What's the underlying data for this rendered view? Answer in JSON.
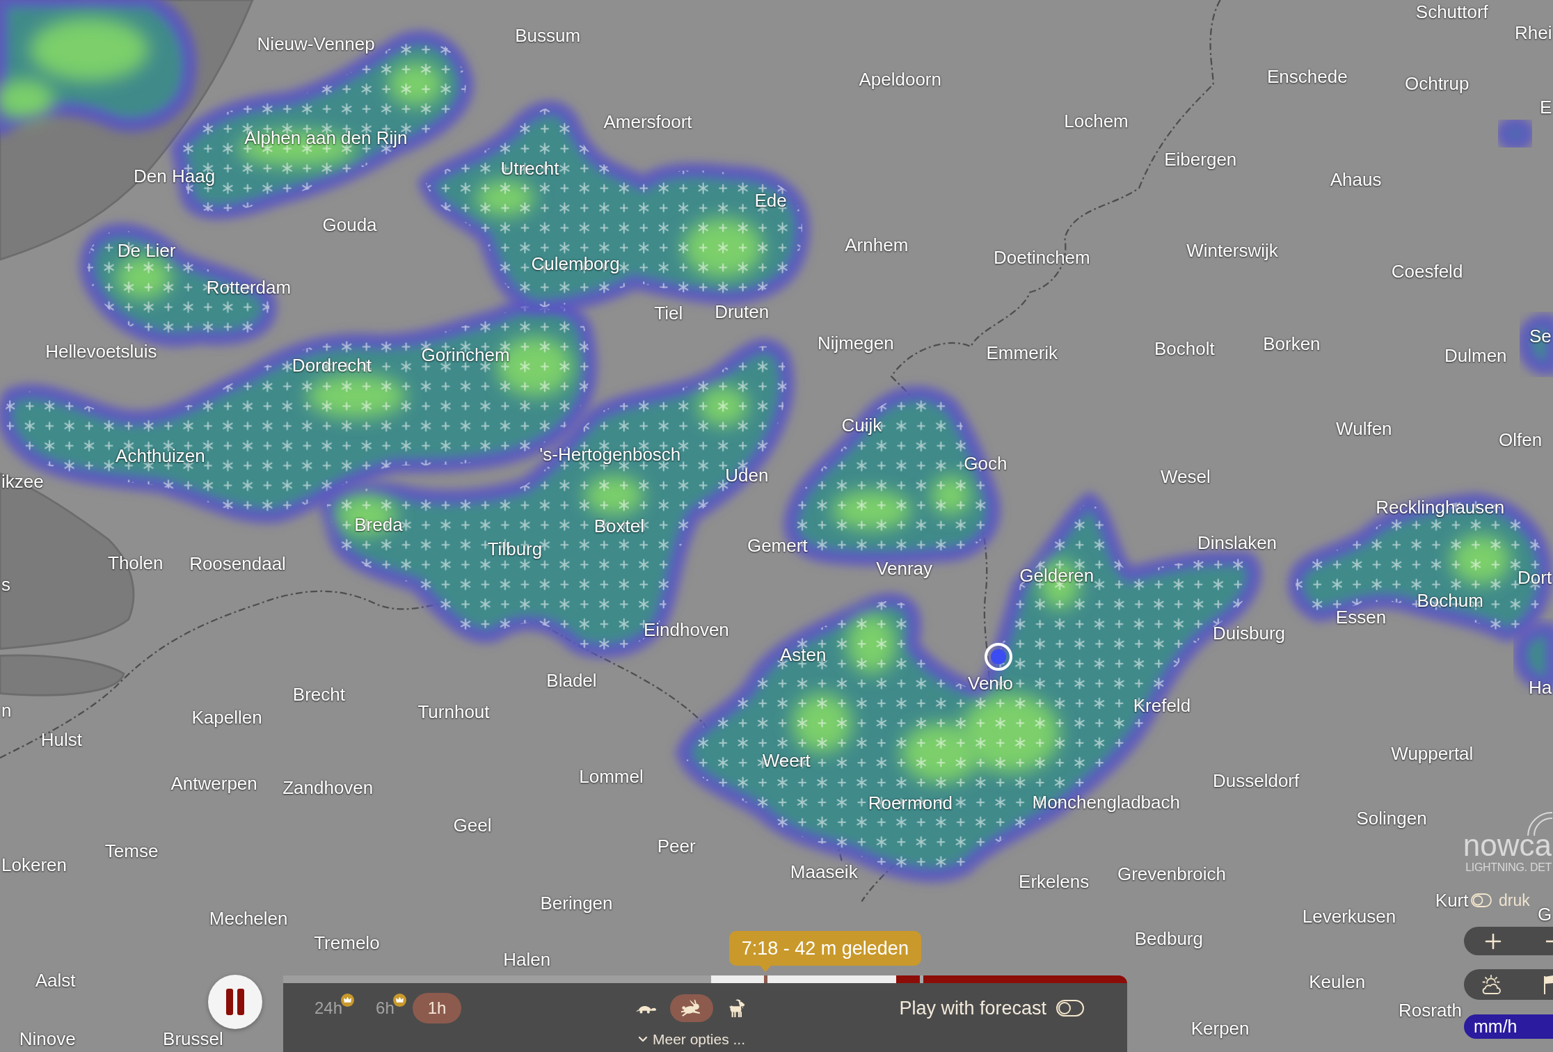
{
  "map": {
    "places": [
      "Schuttorf",
      "Nieuw-Vennep",
      "Bussum",
      "Rhei",
      "Apeldoorn",
      "Enschede",
      "Ochtrup",
      "Alphen aan den Rijn",
      "Amersfoort",
      "Lochem",
      "E",
      "Den Haag",
      "Utrecht",
      "Eibergen",
      "Ahaus",
      "Ede",
      "Gouda",
      "De Lier",
      "Culemborg",
      "Arnhem",
      "Doetinchem",
      "Winterswijk",
      "Rotterdam",
      "Coesfeld",
      "Tiel",
      "Druten",
      "Hellevoetsluis",
      "Dordrecht",
      "Gorinchem",
      "Nijmegen",
      "Emmerik",
      "Bocholt",
      "Borken",
      "Dulmen",
      "Se",
      "Cuijk",
      "Wulfen",
      "Achthuizen",
      "'s-Hertogenbosch",
      "Olfen",
      "ikzee",
      "Uden",
      "Goch",
      "Wesel",
      "Breda",
      "Boxtel",
      "Recklinghausen",
      "Tholen",
      "Roosendaal",
      "Tilburg",
      "Gemert",
      "Dinslaken",
      "s",
      "Venray",
      "Gelderen",
      "Dort",
      "Eindhoven",
      "Duisburg",
      "Essen",
      "Bochum",
      "Asten",
      "n",
      "Brecht",
      "Kapellen",
      "Turnhout",
      "Bladel",
      "Venlo",
      "Krefeld",
      "Ha",
      "Hulst",
      "Antwerpen",
      "Zandhoven",
      "Lommel",
      "Weert",
      "Wuppertal",
      "Dusseldorf",
      "Roermond",
      "Monchengladbach",
      "Geel",
      "Solingen",
      "Lokeren",
      "Temse",
      "Peer",
      "Maaseik",
      "Erkelens",
      "Grevenbroich",
      "Mechelen",
      "Beringen",
      "Leverkusen",
      "Kurt",
      "G",
      "Tremelo",
      "Aalst",
      "Halen",
      "Bedburg",
      "Keulen",
      "Ninove",
      "Brussel",
      "Kerpen",
      "Rosrath"
    ]
  },
  "logo": {
    "wordmark": "nowca",
    "tagline": "LIGHTNING. DET"
  },
  "layer_toggle": {
    "label": "druk",
    "on": false
  },
  "unit": "mm/h",
  "playback": {
    "playing": true,
    "tooltip": "7:18 - 42 m geleden",
    "timeline": {
      "loaded": {
        "level": 0.445
      },
      "position": {
        "level": 0.13
      },
      "now_marker": {
        "level": 0.505
      }
    },
    "ranges": [
      {
        "label": "24h",
        "premium": true,
        "selected": false
      },
      {
        "label": "6h",
        "premium": true,
        "selected": false
      },
      {
        "label": "1h",
        "premium": false,
        "selected": true
      }
    ],
    "speeds": [
      {
        "kind": "turtle",
        "selected": false
      },
      {
        "kind": "rabbit",
        "selected": true
      },
      {
        "kind": "goat",
        "selected": false
      }
    ],
    "forecast": {
      "label": "Play with forecast",
      "on": false
    },
    "more_options": "Meer opties ..."
  }
}
